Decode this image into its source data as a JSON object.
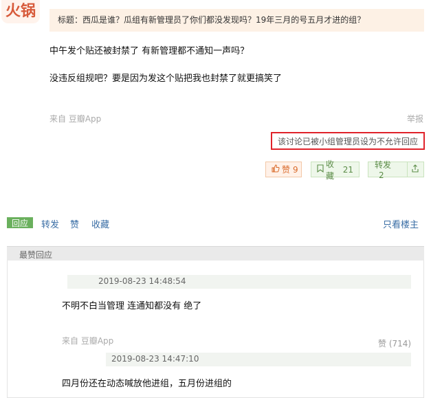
{
  "post": {
    "quote": "标题：西瓜是谁？瓜组有新管理员了你们都没发现吗？19年三月的号五月才进的组？",
    "paragraph1": "中午发个贴还被封禁了 有新管理都不通知一声吗？",
    "paragraph2": "没违反组规吧？要是因为发这个贴把我也封禁了就更搞笑了",
    "source": "来自 豆瓣App",
    "report": "举报",
    "notice": "该讨论已被小组管理员设为不允许回应",
    "like_label": "赞",
    "like_count": "9",
    "fav_label": "收藏",
    "fav_count": "21",
    "share_label": "转发",
    "share_count": "2"
  },
  "actions": {
    "reply": "回应",
    "repost": "转发",
    "like": "赞",
    "collect": "收藏",
    "only_op": "只看楼主"
  },
  "best_replies": {
    "title": "最赞回应",
    "items": [
      {
        "time": "2019-08-23 14:48:54",
        "text": "不明不白当管理 连通知都没有 绝了",
        "source": "来自 豆瓣App",
        "likes": "赞 (714)"
      },
      {
        "time": "2019-08-23 14:47:10",
        "text": "四月份还在动态喊放他进组，五月份进组的"
      }
    ]
  },
  "icons": {
    "like": "thumbs-up-icon",
    "fav": "bookmark-icon",
    "share": "share-icon"
  },
  "colors": {
    "notice_border": "#e0222a",
    "reply_button": "#6ab05d",
    "link": "#3a6ea5"
  }
}
